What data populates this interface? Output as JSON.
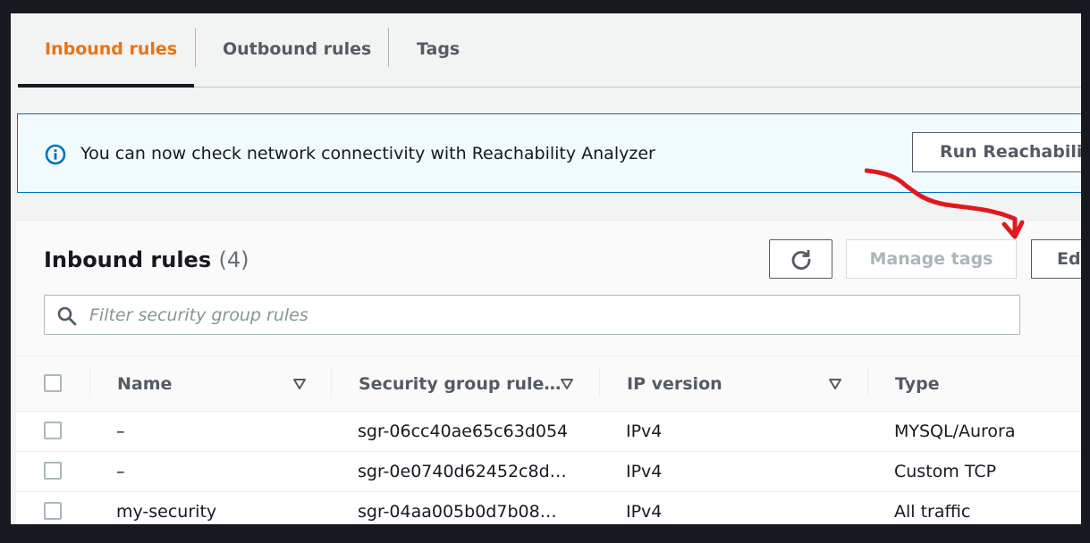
{
  "tabs": [
    {
      "label": "Inbound rules",
      "active": true
    },
    {
      "label": "Outbound rules",
      "active": false
    },
    {
      "label": "Tags",
      "active": false
    }
  ],
  "banner": {
    "icon": "info-icon",
    "text": "You can now check network connectivity with Reachability Analyzer",
    "button_label": "Run Reachability Analyzer"
  },
  "panel": {
    "title": "Inbound rules",
    "count": "(4)",
    "refresh_icon": "refresh-icon",
    "manage_tags_label": "Manage tags",
    "edit_label": "Edit inbound rules",
    "filter_placeholder": "Filter security group rules"
  },
  "table": {
    "columns": [
      "Name",
      "Security group rule…",
      "IP version",
      "Type"
    ],
    "rows": [
      {
        "name": "–",
        "rule_id": "sgr-06cc40ae65c63d054",
        "ip_version": "IPv4",
        "type": "MYSQL/Aurora"
      },
      {
        "name": "–",
        "rule_id": "sgr-0e0740d62452c8d…",
        "ip_version": "IPv4",
        "type": "Custom TCP"
      },
      {
        "name": "my-security",
        "rule_id": "sgr-04aa005b0d7b08…",
        "ip_version": "IPv4",
        "type": "All traffic"
      }
    ]
  },
  "colors": {
    "accent": "#ec7211",
    "info_blue": "#0073bb",
    "annotation_red": "#e0191e"
  }
}
